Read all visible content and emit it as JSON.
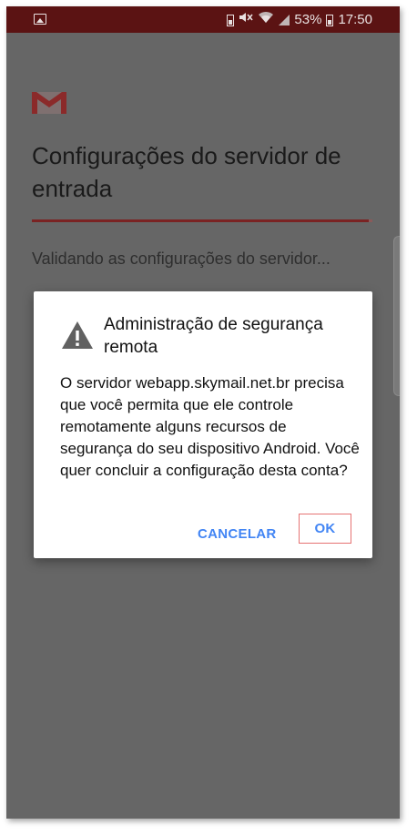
{
  "status_bar": {
    "battery_percent": "53%",
    "time": "17:50"
  },
  "screen": {
    "title": "Configurações do servidor de entrada",
    "validating_text": "Validando as configurações do servidor...",
    "progress": 0.99
  },
  "dialog": {
    "title": "Administração de segurança remota",
    "message": "O servidor webapp.skymail.net.br precisa que você permita que ele controle remotamente alguns recursos de segurança do seu dispositivo Android. Você quer concluir a configuração desta conta?",
    "cancel_label": "CANCELAR",
    "ok_label": "OK"
  },
  "colors": {
    "status_bar": "#5b1313",
    "overlay": "#666666",
    "accent_button": "#4285f4",
    "ok_highlight": "#e57373",
    "gmail_red": "#8b2a2a"
  },
  "icons": {
    "gallery": "image-icon",
    "status_set": [
      "battery-saver-icon",
      "mute-icon",
      "wifi-icon",
      "signal-icon",
      "battery-icon"
    ],
    "app_logo": "gmail-logo-icon",
    "dialog_icon": "warning-icon"
  }
}
